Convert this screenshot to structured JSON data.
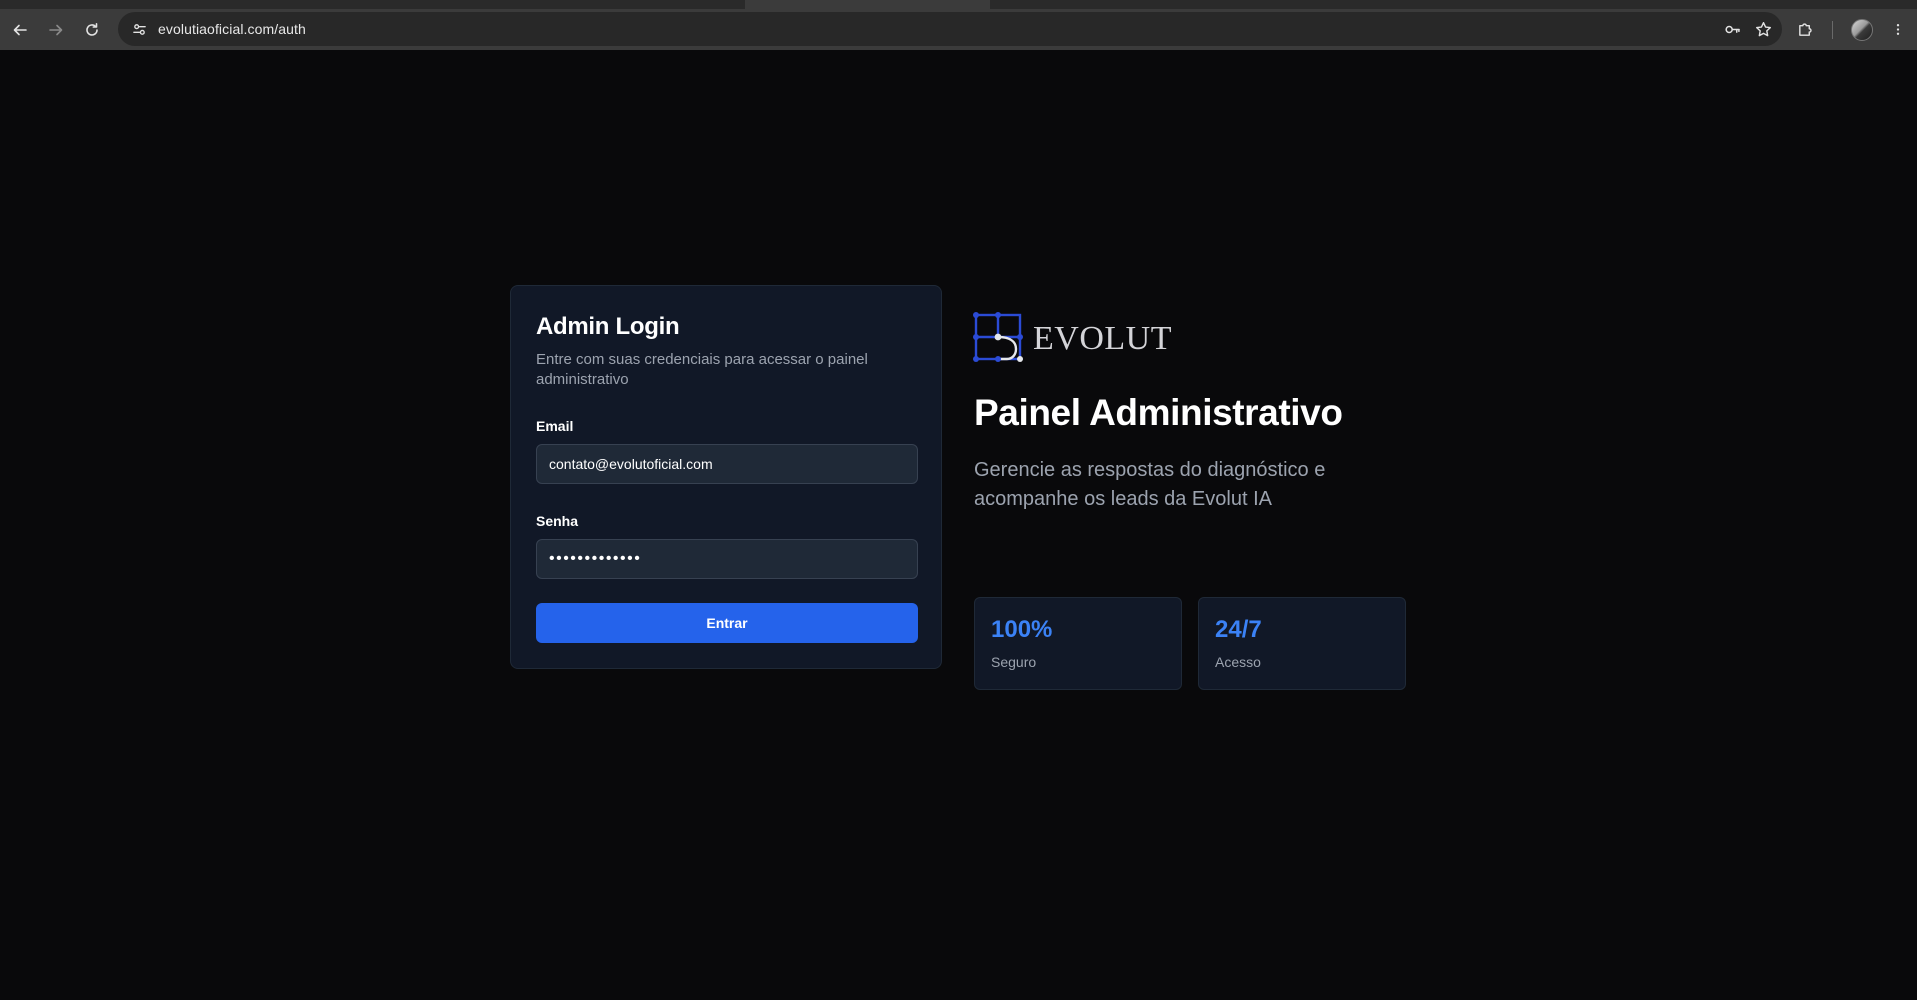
{
  "browser": {
    "url": "evolutiaoficial.com/auth",
    "icons": {
      "back": "arrow-left-icon",
      "forward": "arrow-right-icon",
      "reload": "reload-icon",
      "site_info": "tune-icon",
      "password_manager": "key-icon",
      "bookmark": "star-icon",
      "extensions": "puzzle-icon",
      "menu": "kebab-menu-icon"
    }
  },
  "login": {
    "title": "Admin Login",
    "subtitle": "Entre com suas credenciais para acessar o painel administrativo",
    "email_label": "Email",
    "email_value": "contato@evolutoficial.com",
    "password_label": "Senha",
    "password_value": "•••••••••••••",
    "submit_label": "Entrar"
  },
  "brand": {
    "logo_text": "EVOLUT"
  },
  "hero": {
    "title": "Painel Administrativo",
    "description": "Gerencie as respostas do diagnóstico e acompanhe os leads da Evolut IA"
  },
  "stats": [
    {
      "value": "100%",
      "label": "Seguro"
    },
    {
      "value": "24/7",
      "label": "Acesso"
    }
  ],
  "colors": {
    "background": "#09090b",
    "card": "#111827",
    "card_border": "#1f2937",
    "input": "#1f2937",
    "accent": "#2563eb",
    "stat_value": "#3b82f6",
    "muted_text": "#9ca3af"
  }
}
